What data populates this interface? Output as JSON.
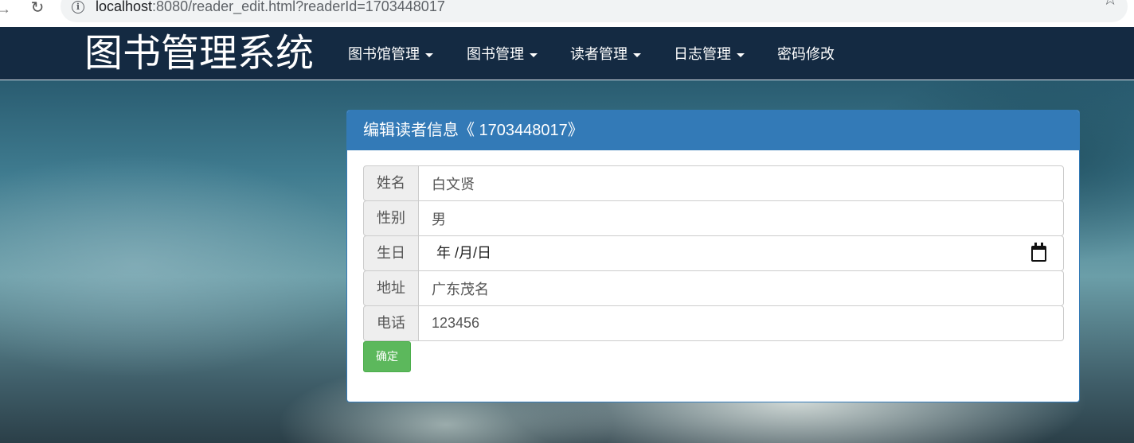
{
  "browser": {
    "url_host": "localhost",
    "url_rest": ":8080/reader_edit.html?readerId=1703448017"
  },
  "navbar": {
    "brand": "图书管理系统",
    "items": [
      {
        "label": "图书馆管理",
        "dropdown": true
      },
      {
        "label": "图书管理",
        "dropdown": true
      },
      {
        "label": "读者管理",
        "dropdown": true
      },
      {
        "label": "日志管理",
        "dropdown": true
      },
      {
        "label": "密码修改",
        "dropdown": false
      }
    ]
  },
  "panel": {
    "title": "编辑读者信息《 1703448017》"
  },
  "form": {
    "name": {
      "label": "姓名",
      "value": "白文贤"
    },
    "sex": {
      "label": "性别",
      "value": "男"
    },
    "birth": {
      "label": "生日",
      "placeholder": "年 /月/日"
    },
    "address": {
      "label": "地址",
      "value": "广东茂名"
    },
    "phone": {
      "label": "电话",
      "value": "123456"
    },
    "submit_label": "确定"
  },
  "colors": {
    "navbar_bg": "#142a42",
    "panel_primary": "#337ab7",
    "success_button": "#5cb85c"
  }
}
